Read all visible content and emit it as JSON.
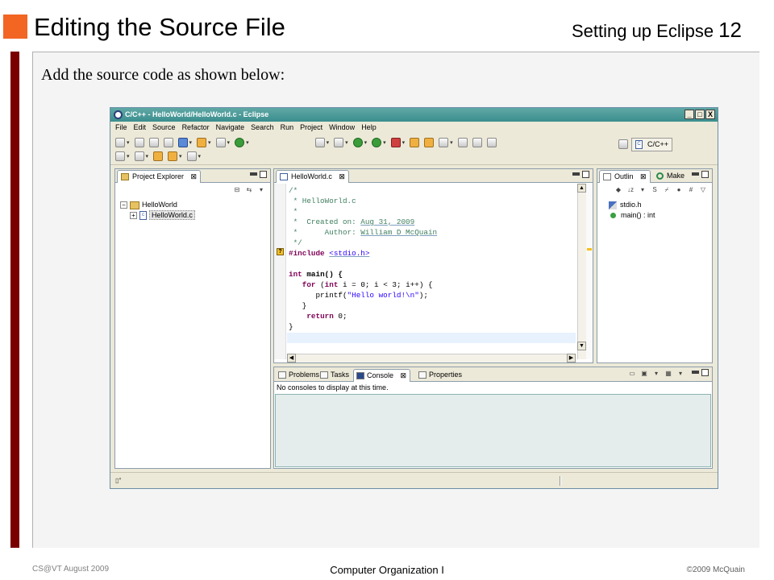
{
  "slide": {
    "title": "Editing the Source File",
    "header_right": "Setting up Eclipse",
    "page_number": "12",
    "intro": "Add the source code as shown below:",
    "footer_left": "CS@VT August 2009",
    "footer_center": "Computer Organization I",
    "footer_right": "©2009  McQuain",
    "colors": {
      "accent_square": "#f26522",
      "left_bar": "#7a0000"
    }
  },
  "eclipse": {
    "window_title": "C/C++ - HelloWorld/HelloWorld.c - Eclipse",
    "window_buttons": {
      "minimize": "_",
      "maximize": "□",
      "close": "X"
    },
    "menu": [
      "File",
      "Edit",
      "Source",
      "Refactor",
      "Navigate",
      "Search",
      "Run",
      "Project",
      "Window",
      "Help"
    ],
    "perspective_label": "C/C++",
    "project_explorer": {
      "tab_label": "Project Explorer",
      "close": "⊠",
      "project": "HelloWorld",
      "file": "HelloWorld.c",
      "expander_project": "−",
      "expander_file": "+"
    },
    "editor": {
      "tab_label": "HelloWorld.c",
      "close": "⊠",
      "warning_marker": "?",
      "lines": {
        "l1": "/*",
        "l2": " * HelloWorld.c",
        "l3": " *",
        "l4_a": " *  Created on: ",
        "l4_b": "Aug 31, 2009",
        "l5_a": " *      Author: ",
        "l5_b": "William D McQuain",
        "l6": " */",
        "l7_k": "#include",
        "l7_b": " ",
        "l7_c": "<stdio.h>",
        "l8": "",
        "l9_k": "int",
        "l9_b": " main() {",
        "l10_a": "   ",
        "l10_k": "for",
        "l10_b": " (",
        "l10_k2": "int",
        "l10_c": " i = 0; i < 3; i++) {",
        "l11_a": "      printf(",
        "l11_s": "\"Hello world!\\n\"",
        "l11_b": ");",
        "l12": "   }",
        "l13_a": "    ",
        "l13_k": "return",
        "l13_b": " 0;",
        "l14": "}"
      }
    },
    "outline": {
      "tab_label": "Outlin",
      "close": "⊠",
      "tab2_label": "Make",
      "items": [
        "stdio.h",
        "main() : int"
      ]
    },
    "bottom": {
      "tabs": [
        "Problems",
        "Tasks",
        "Console",
        "Properties"
      ],
      "console_close": "⊠",
      "console_message": "No consoles to display at this time."
    },
    "status_icon": "▯°",
    "colors": {
      "titlebar": "#3b8e8e",
      "comment": "#3f7f5f",
      "keyword": "#7f0055",
      "string": "#2a00ff",
      "current_line": "#e8f2fe"
    }
  }
}
